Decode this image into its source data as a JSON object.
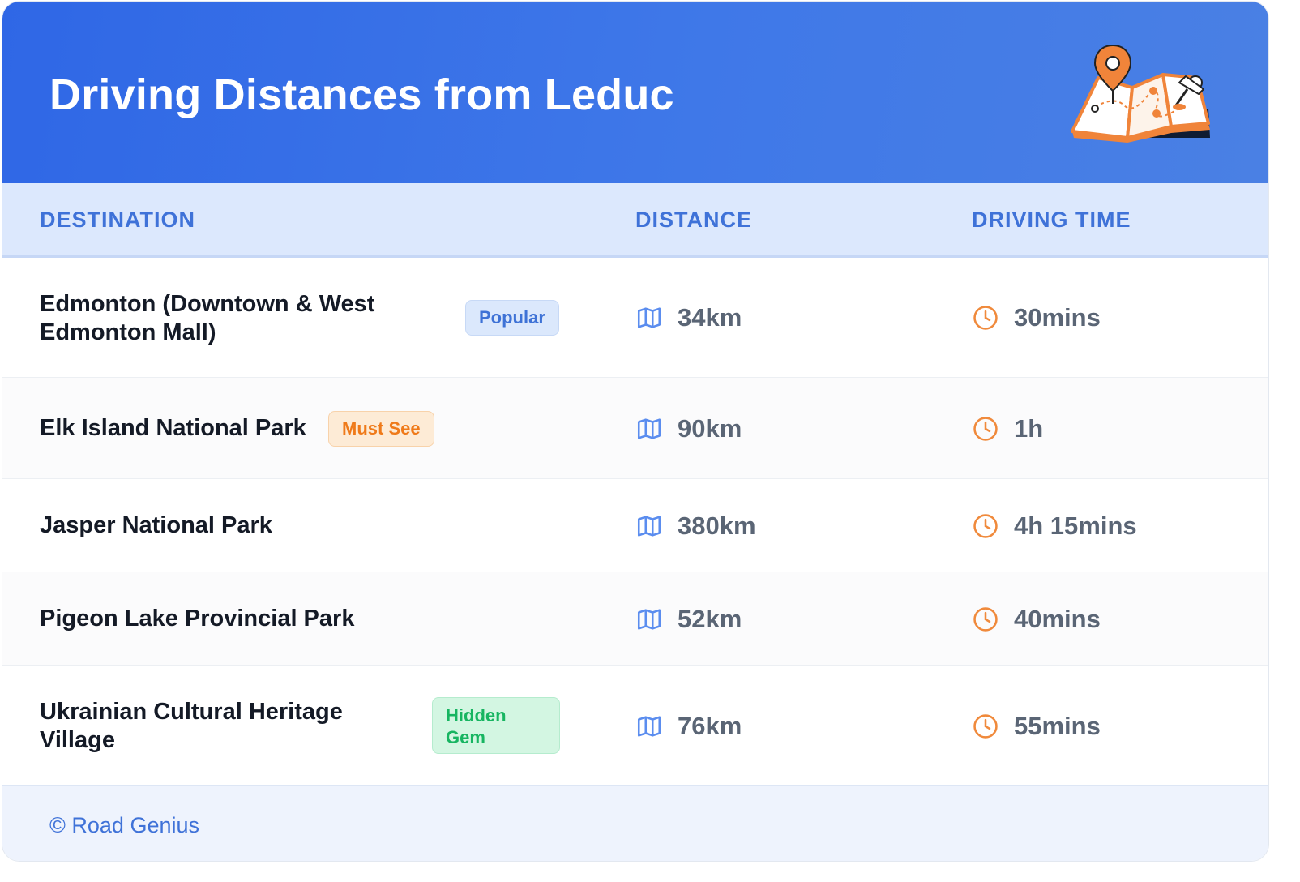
{
  "header": {
    "title": "Driving Distances from Leduc"
  },
  "table": {
    "columns": [
      "DESTINATION",
      "DISTANCE",
      "DRIVING TIME"
    ],
    "rows": [
      {
        "destination": "Edmonton (Downtown & West Edmonton Mall)",
        "badge": "Popular",
        "badge_color": "#dbe8fc",
        "distance": "34km",
        "time": "30mins"
      },
      {
        "destination": "Elk Island National Park",
        "badge": "Must See",
        "badge_color": "#fdebd6",
        "distance": "90km",
        "time": "1h"
      },
      {
        "destination": "Jasper National Park",
        "badge": "",
        "distance": "380km",
        "time": "4h 15mins"
      },
      {
        "destination": "Pigeon Lake Provincial Park",
        "badge": "",
        "distance": "52km",
        "time": "40mins"
      },
      {
        "destination": "Ukrainian Cultural Heritage Village",
        "badge": "Hidden Gem",
        "badge_color": "#d3f6e2",
        "distance": "76km",
        "time": "55mins"
      }
    ]
  },
  "footer": {
    "text": "© Road Genius"
  },
  "icons": {
    "distance": "map-icon",
    "time": "clock-icon",
    "header": "map-with-pin-illustration"
  },
  "colors": {
    "header_bg": "#2f67e6",
    "accent_blue": "#3f72d8",
    "icon_orange": "#f08a3c",
    "icon_blue": "#5b8def"
  }
}
